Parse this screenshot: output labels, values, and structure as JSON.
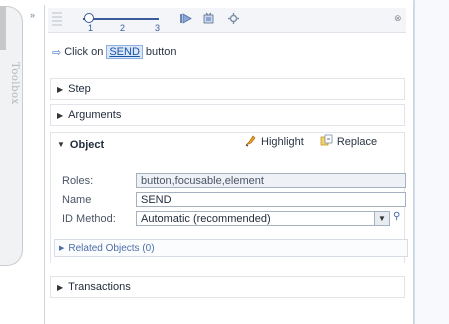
{
  "toolbox": {
    "label": "Toolbox"
  },
  "toolbar": {
    "slider_ticks": [
      "1",
      "2",
      "3"
    ],
    "level": 1
  },
  "step_description": {
    "prefix": "Click on",
    "target": "SEND",
    "suffix": "button"
  },
  "sections": {
    "step": "Step",
    "arguments": "Arguments",
    "object": "Object",
    "transactions": "Transactions"
  },
  "object_actions": {
    "highlight": "Highlight",
    "replace": "Replace"
  },
  "object_fields": {
    "roles_label": "Roles:",
    "roles_value": "button,focusable,element",
    "name_label": "Name",
    "name_value": "SEND",
    "id_method_label": "ID Method:",
    "id_method_value": "Automatic (recommended)"
  },
  "related_objects": "Related Objects (0)",
  "colors": {
    "accent": "#1a56a8",
    "panel_border": "#cdd5df"
  }
}
